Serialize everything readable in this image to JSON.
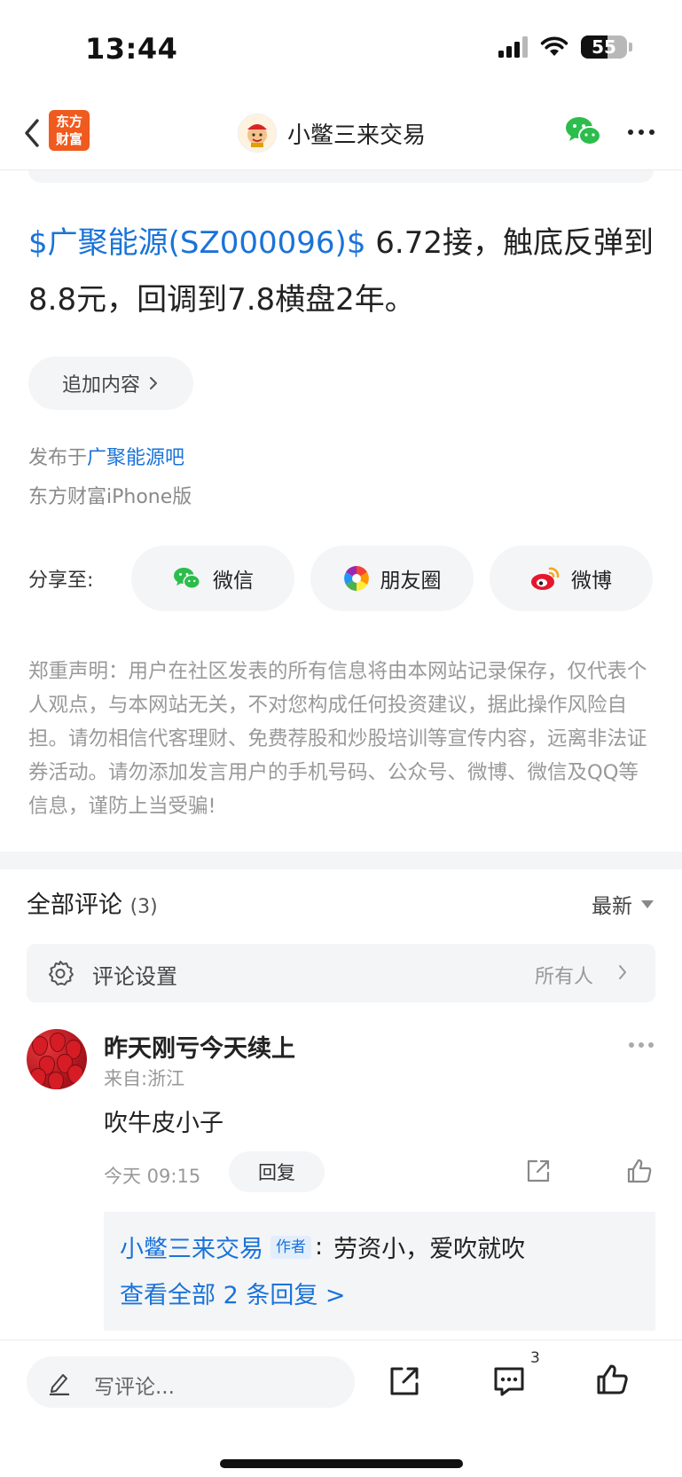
{
  "status_bar": {
    "time": "13:44",
    "battery": "55"
  },
  "nav": {
    "brand_line1": "东方",
    "brand_line2": "财富",
    "title": "小鳖三来交易"
  },
  "post": {
    "stock_link": "$广聚能源(SZ000096)$",
    "text": " 6.72接，触底反弹到8.8元，回调到7.8横盘2年。",
    "append_label": "追加内容",
    "posted_in_prefix": "发布于",
    "forum_name": "广聚能源吧",
    "client": "东方财富iPhone版"
  },
  "share": {
    "label": "分享至:",
    "wechat": "微信",
    "moments": "朋友圈",
    "weibo": "微博"
  },
  "disclaimer": "郑重声明：用户在社区发表的所有信息将由本网站记录保存，仅代表个人观点，与本网站无关，不对您构成任何投资建议，据此操作风险自担。请勿相信代客理财、免费荐股和炒股培训等宣传内容，远离非法证券活动。请勿添加发言用户的手机号码、公众号、微博、微信及QQ等信息，谨防上当受骗!",
  "comments": {
    "title": "全部评论",
    "count": "(3)",
    "sort_label": "最新",
    "settings_label": "评论设置",
    "settings_value": "所有人",
    "items": [
      {
        "user": "昨天刚亏今天续上",
        "location": "来自:浙江",
        "text": "吹牛皮小子",
        "time": "今天 09:15",
        "reply_label": "回复",
        "reply_preview": {
          "author": "小鳖三来交易",
          "author_tag": "作者",
          "separator": ":",
          "text": "劳资小，爱吹就吹"
        },
        "view_all": "查看全部 2 条回复 >"
      }
    ]
  },
  "bottom_bar": {
    "placeholder": "写评论...",
    "comment_count": "3"
  }
}
